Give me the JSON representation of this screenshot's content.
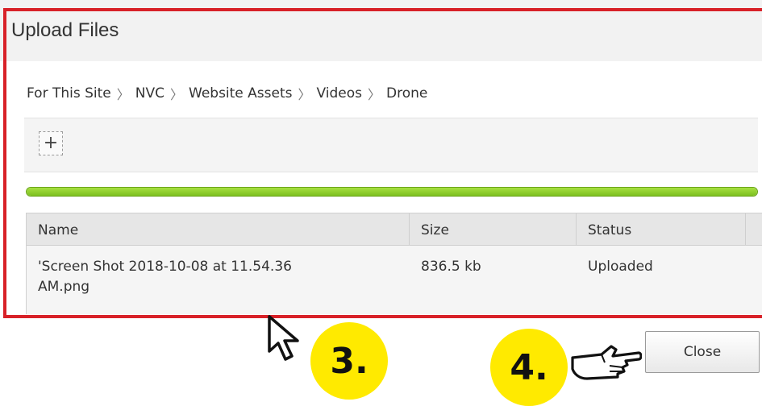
{
  "dialog": {
    "title": "Upload Files"
  },
  "breadcrumb": {
    "items": [
      "For This Site",
      "NVC",
      "Website Assets",
      "Videos",
      "Drone"
    ],
    "separator": "〉"
  },
  "toolbar": {
    "add_label": "+"
  },
  "progress": {
    "fraction": 1.0
  },
  "table": {
    "columns": [
      "Name",
      "Size",
      "Status"
    ],
    "rows": [
      {
        "name_line1": "'Screen Shot 2018-10-08 at 11.54.36",
        "name_line2": "AM.png",
        "size": "836.5 kb",
        "status": "Uploaded"
      }
    ]
  },
  "buttons": {
    "close_label": "Close"
  },
  "annotations": {
    "step3": "3.",
    "step4": "4.",
    "highlight_color": "#d82128",
    "badge_color": "#ffea00"
  },
  "icons": {
    "add": "plus-icon",
    "cursor3": "mouse-pointer-icon",
    "cursor4": "pointing-hand-icon"
  }
}
